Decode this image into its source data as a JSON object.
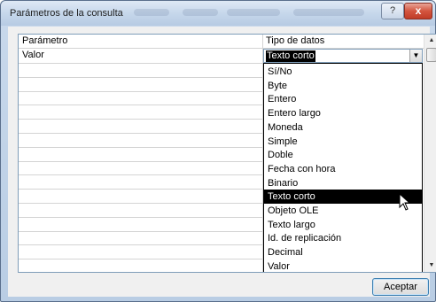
{
  "window": {
    "title": "Parámetros de la consulta",
    "help_label": "?",
    "close_label": "x"
  },
  "grid": {
    "columns": [
      "Parámetro",
      "Tipo de datos"
    ],
    "rows": [
      {
        "parameter": "Valor",
        "type": "Texto corto"
      }
    ]
  },
  "dropdown": {
    "options": [
      "Sí/No",
      "Byte",
      "Entero",
      "Entero largo",
      "Moneda",
      "Simple",
      "Doble",
      "Fecha con hora",
      "Binario",
      "Texto corto",
      "Objeto OLE",
      "Texto largo",
      "Id. de replicación",
      "Decimal",
      "Valor"
    ],
    "selected": "Texto corto",
    "combo_arrow": "▼"
  },
  "scrollbar": {
    "up_arrow": "▲",
    "down_arrow": "▼"
  },
  "footer": {
    "accept_label": "Aceptar"
  },
  "colors": {
    "selection_bg": "#000000",
    "selection_fg": "#ffffff",
    "accent_border": "#3c7fb1"
  }
}
